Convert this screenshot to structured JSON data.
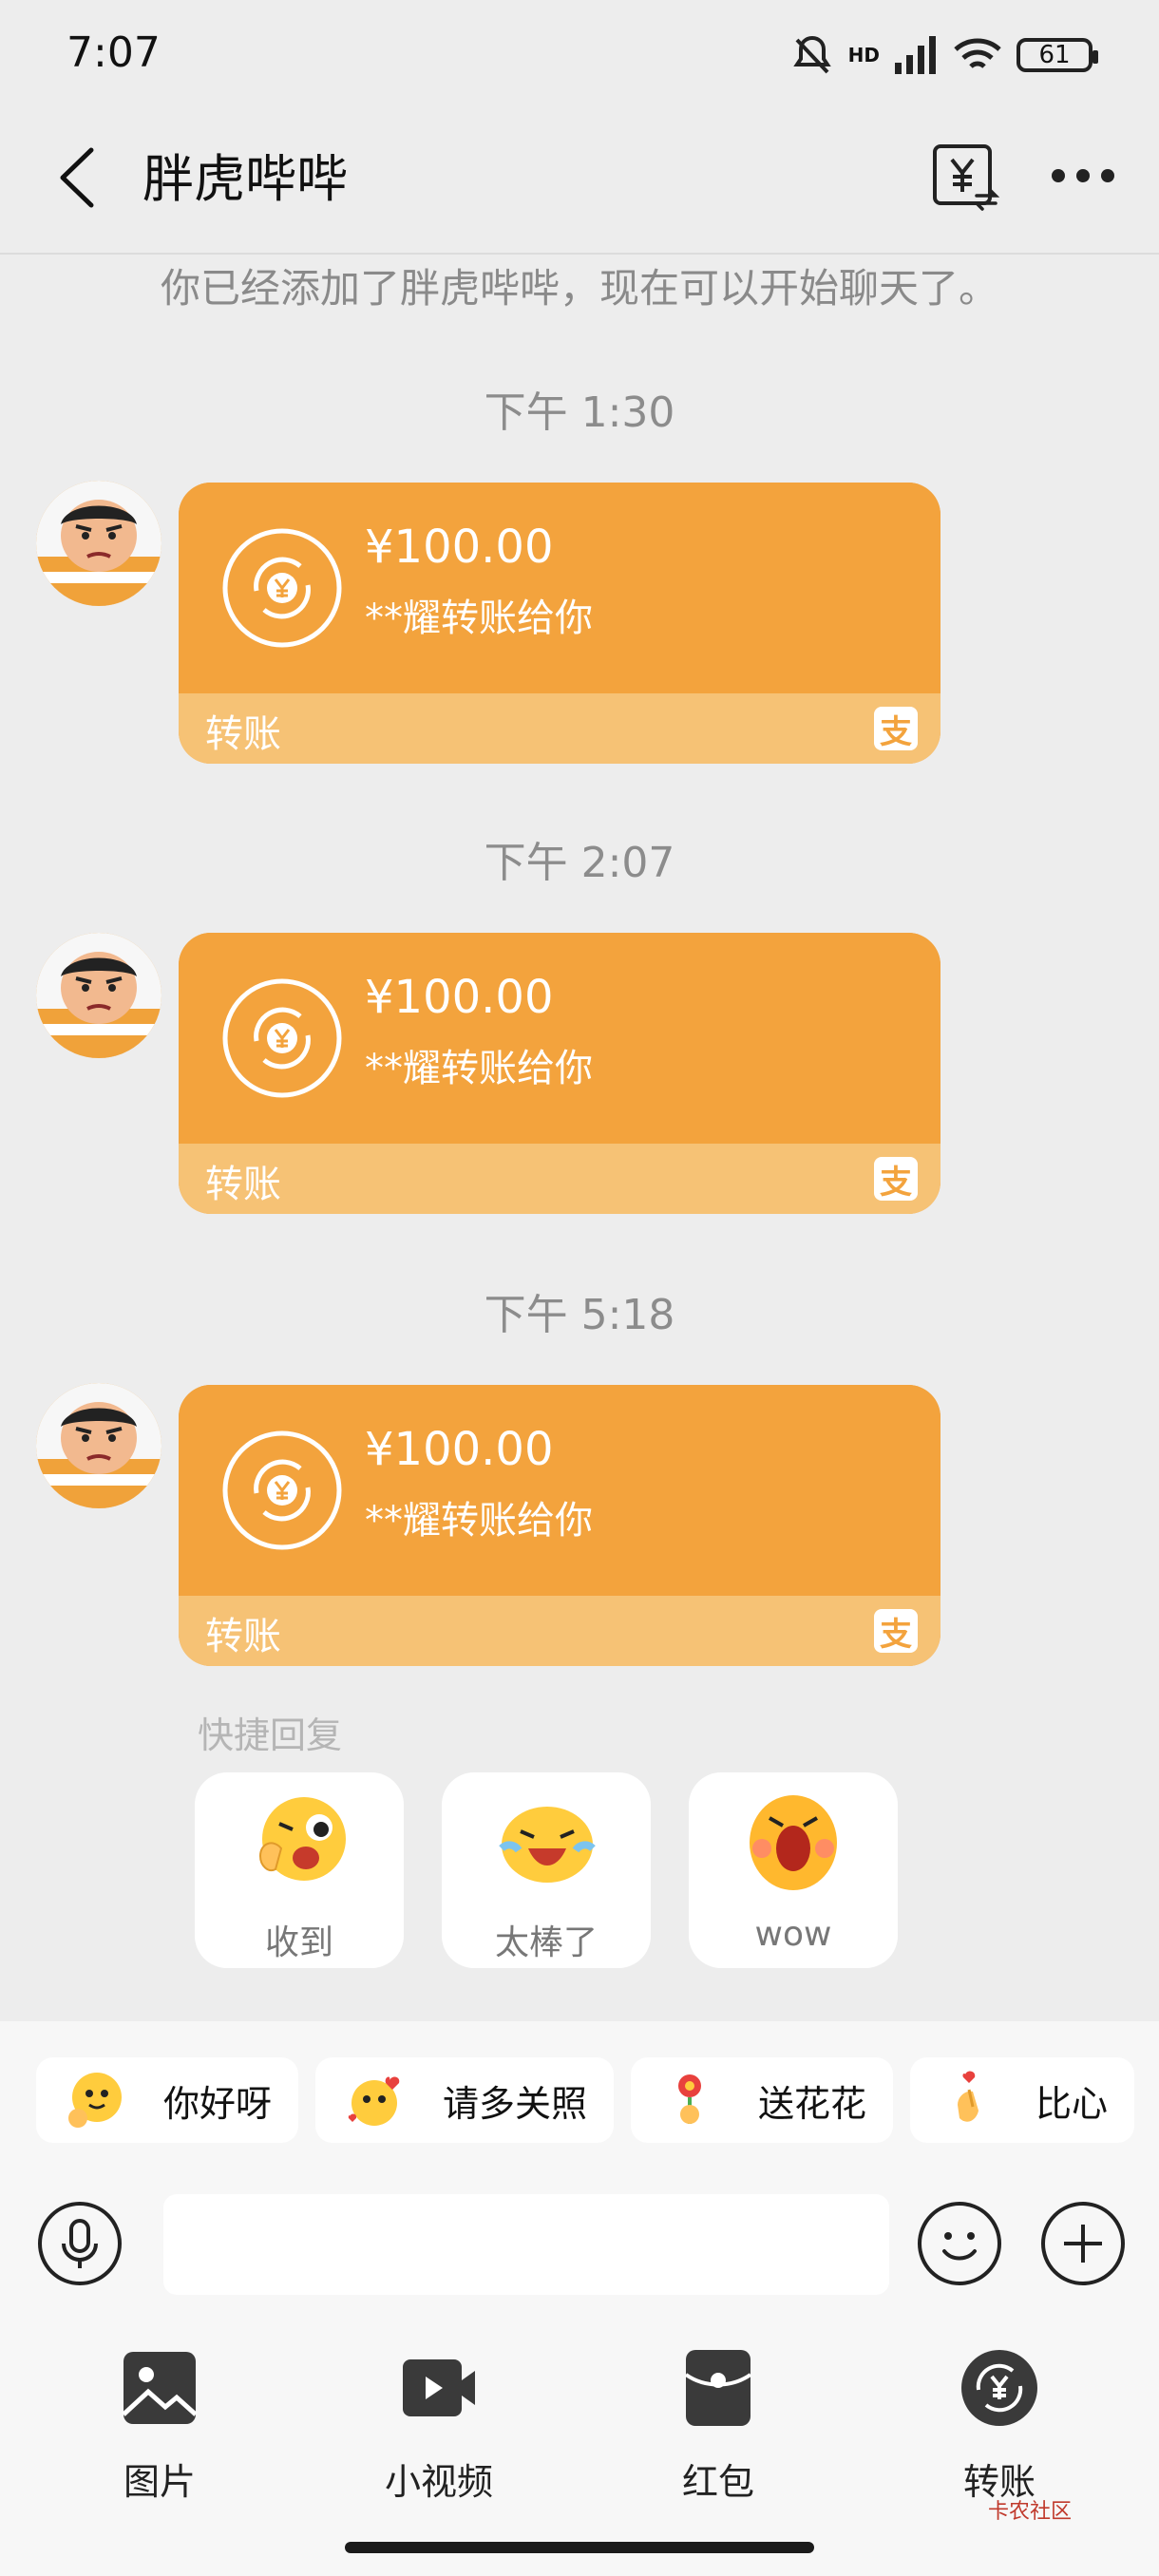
{
  "status_bar": {
    "time": "7:07",
    "battery": "61",
    "network": "HD"
  },
  "nav": {
    "title": "胖虎哔哔"
  },
  "system_message": "你已经添加了胖虎哔哔，现在可以开始聊天了。",
  "messages": [
    {
      "time": "下午 1:30",
      "amount": "¥100.00",
      "desc": "**耀转账给你",
      "label": "转账"
    },
    {
      "time": "下午 2:07",
      "amount": "¥100.00",
      "desc": "**耀转账给你",
      "label": "转账"
    },
    {
      "time": "下午 5:18",
      "amount": "¥100.00",
      "desc": "**耀转账给你",
      "label": "转账"
    }
  ],
  "quick_reply": {
    "title": "快捷回复",
    "items": [
      {
        "label": "收到"
      },
      {
        "label": "太棒了"
      },
      {
        "label": "wow"
      }
    ]
  },
  "sticker_chips": [
    {
      "label": "你好呀"
    },
    {
      "label": "请多关照"
    },
    {
      "label": "送花花"
    },
    {
      "label": "比心"
    }
  ],
  "input": {
    "placeholder": ""
  },
  "tools": [
    {
      "label": "图片"
    },
    {
      "label": "小视频"
    },
    {
      "label": "红包"
    },
    {
      "label": "转账"
    }
  ],
  "watermark": "卡农社区",
  "colors": {
    "card": "#f3a33d",
    "card_bottom": "#f6c275",
    "background": "#ededed"
  }
}
